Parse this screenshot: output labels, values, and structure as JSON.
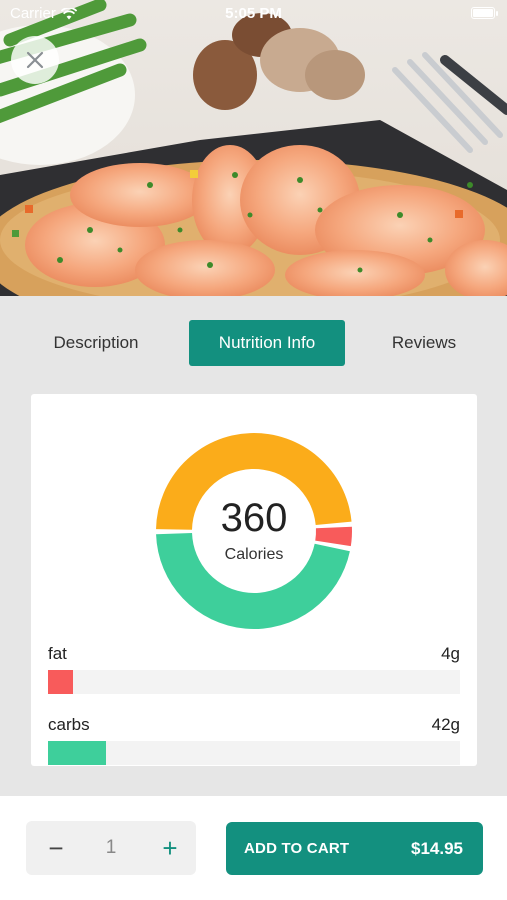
{
  "status_bar": {
    "carrier": "Carrier",
    "time": "5:05 PM"
  },
  "hero": {
    "image_alt": "Shrimp fried rice"
  },
  "tabs": [
    {
      "label": "Description",
      "active": false
    },
    {
      "label": "Nutrition Info",
      "active": true
    },
    {
      "label": "Reviews",
      "active": false
    }
  ],
  "nutrition": {
    "calories_value": "360",
    "calories_label": "Calories",
    "donut_shares": {
      "fat": 0.04,
      "carbs": 0.47,
      "protein": 0.49
    },
    "nutrients": [
      {
        "name": "fat",
        "amount": "4g",
        "fraction": 0.06,
        "color": "#f85b5b"
      },
      {
        "name": "carbs",
        "amount": "42g",
        "fraction": 0.14,
        "color": "#3ecf9b"
      }
    ],
    "colors": {
      "fat": "#f85b5b",
      "carbs": "#3ecf9b",
      "protein": "#fbac1a"
    }
  },
  "quantity": {
    "minus": "−",
    "value": "1",
    "plus": "+"
  },
  "cart": {
    "label": "ADD TO CART",
    "price": "$14.95"
  },
  "accent_color": "#13907f"
}
